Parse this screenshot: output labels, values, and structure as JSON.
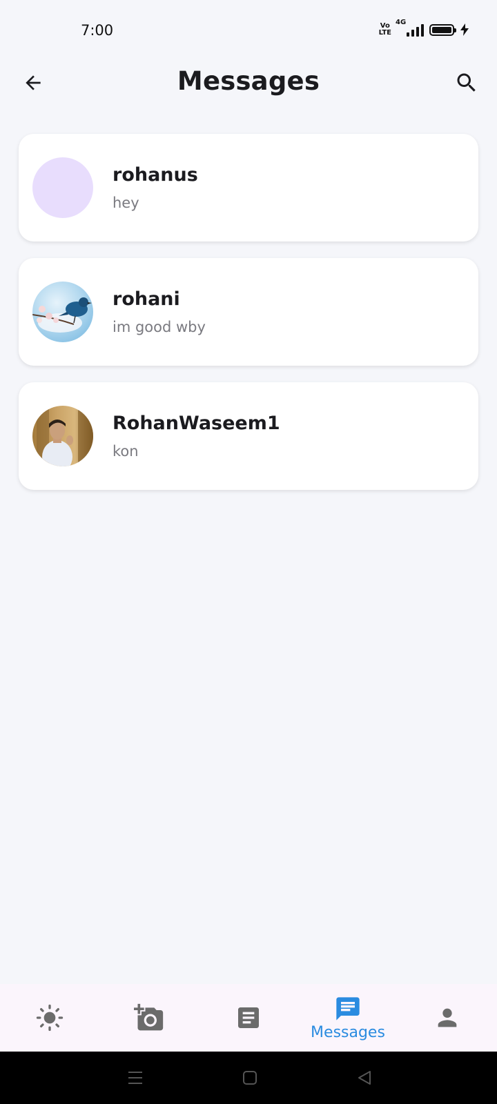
{
  "status_bar": {
    "time": "7:00",
    "network_label": "4G",
    "volte_label": "Vo LTE",
    "icons": [
      "volte-icon",
      "signal-icon",
      "battery-icon",
      "charging-icon"
    ]
  },
  "app_bar": {
    "title": "Messages",
    "back_icon": "arrow-left-icon",
    "search_icon": "search-icon"
  },
  "conversations": [
    {
      "name": "rohanus",
      "preview": "hey",
      "avatar": "plain-avatar"
    },
    {
      "name": "rohani",
      "preview": "im good wby",
      "avatar": "bird-photo-avatar"
    },
    {
      "name": "RohanWaseem1",
      "preview": "kon",
      "avatar": "person-photo-avatar"
    }
  ],
  "bottom_nav": {
    "items": [
      {
        "icon": "sun-icon",
        "label": ""
      },
      {
        "icon": "add-camera-icon",
        "label": ""
      },
      {
        "icon": "document-icon",
        "label": ""
      },
      {
        "icon": "chat-icon",
        "label": "Messages",
        "active": true
      },
      {
        "icon": "person-icon",
        "label": ""
      }
    ],
    "active_color": "#2a8be0",
    "inactive_color": "#6b6b6b"
  },
  "system_nav": {
    "icons": [
      "menu-icon",
      "home-icon",
      "back-triangle-icon"
    ]
  }
}
